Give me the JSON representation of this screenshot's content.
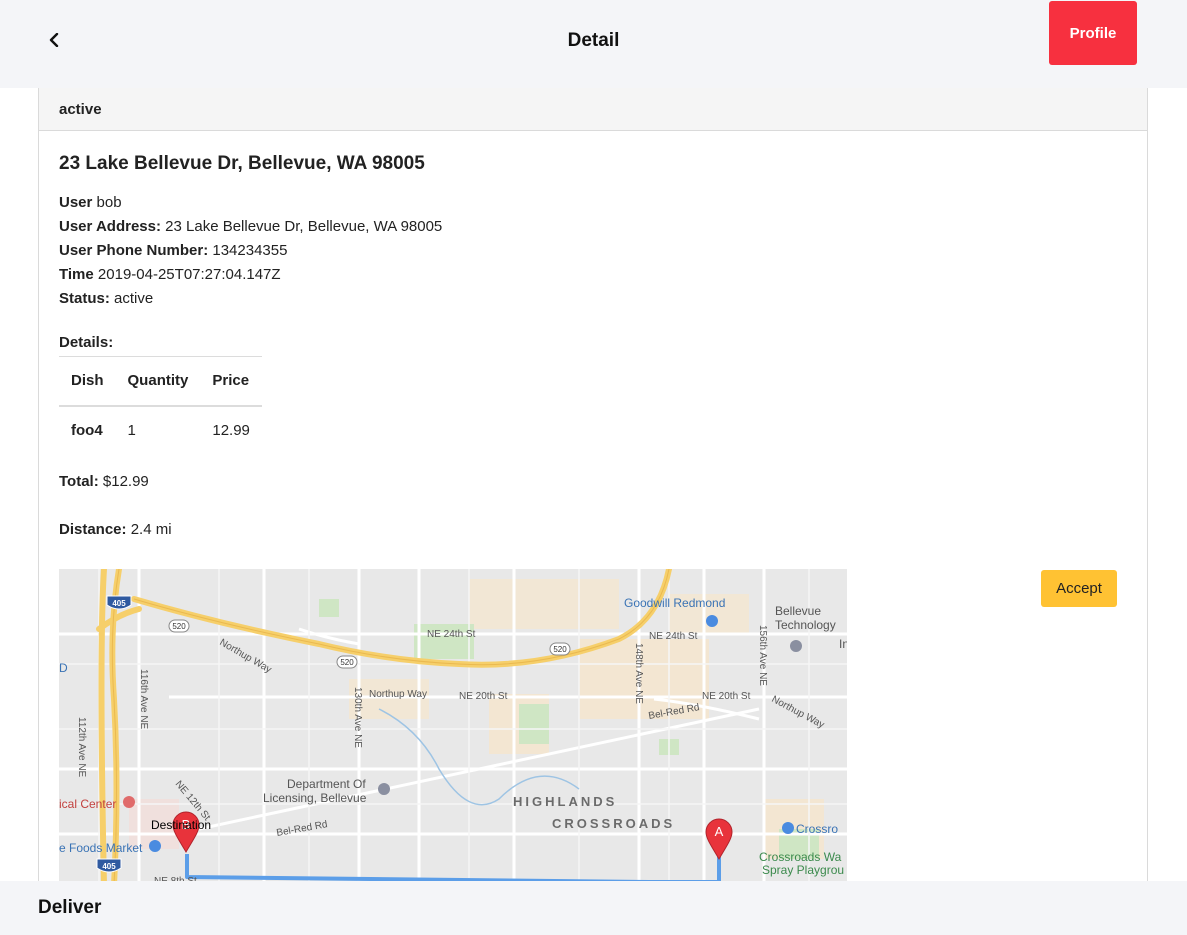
{
  "header": {
    "title": "Detail",
    "back_icon": "chevron-left-icon",
    "profile_label": "Profile",
    "profile_color": "#f7303f"
  },
  "order": {
    "status_header": "active",
    "address_title": "23 Lake Bellevue Dr, Bellevue, WA 98005",
    "fields": [
      {
        "label": "User",
        "value": "bob"
      },
      {
        "label": "User Address:",
        "value": "23 Lake Bellevue Dr, Bellevue, WA 98005"
      },
      {
        "label": "User Phone Number:",
        "value": "134234355"
      },
      {
        "label": "Time",
        "value": "2019-04-25T07:27:04.147Z"
      },
      {
        "label": "Status:",
        "value": "active"
      }
    ],
    "details_label": "Details:",
    "table": {
      "headers": [
        "Dish",
        "Quantity",
        "Price"
      ],
      "rows": [
        {
          "dish": "foo4",
          "quantity": "1",
          "price": "12.99"
        }
      ]
    },
    "total_label": "Total:",
    "total_value": "$12.99",
    "distance_label": "Distance:",
    "distance_value": "2.4 mi",
    "accept_label": "Accept",
    "accept_color": "#ffc233"
  },
  "map": {
    "labels": {
      "goodwill": "Goodwill Redmond",
      "bellevue_tech": "Bellevue",
      "bellevue_tech2": "Technology",
      "ne24_left": "NE 24th St",
      "ne24_right": "NE 24th St",
      "northup_way_left": "Northup Way",
      "northup_way_mid": "Northup Way",
      "ne20_mid": "NE 20th St",
      "ne20_right": "NE 20th St",
      "northup_way_right": "Northup Way",
      "bel_red_right": "Bel-Red Rd",
      "bel_red_left": "Bel-Red Rd",
      "ave116": "116th Ave NE",
      "ave112": "112th Ave NE",
      "ave130": "130th Ave NE",
      "ave148": "148th Ave NE",
      "ave156": "156th Ave NE",
      "ne12": "NE 12th St",
      "ne8": "NE 8th St",
      "dept1": "Department Of",
      "dept2": "Licensing, Bellevue",
      "highlands": "HIGHLANDS",
      "crossroads": "CROSSROADS",
      "medical": "ical Center",
      "foods": "e Foods Market",
      "destination": "Destination",
      "crossro": "Crossro",
      "playground1": "Crossroads Wa",
      "playground2": "Spray Playgrou",
      "d_left": "D",
      "in_right": "In",
      "shield_405_top": "405",
      "shield_405_bottom": "405",
      "shield_520_a": "520",
      "shield_520_b": "520",
      "shield_520_c": "520",
      "marker_a": "A",
      "marker_b": "B"
    }
  },
  "footer": {
    "title": "Deliver"
  }
}
